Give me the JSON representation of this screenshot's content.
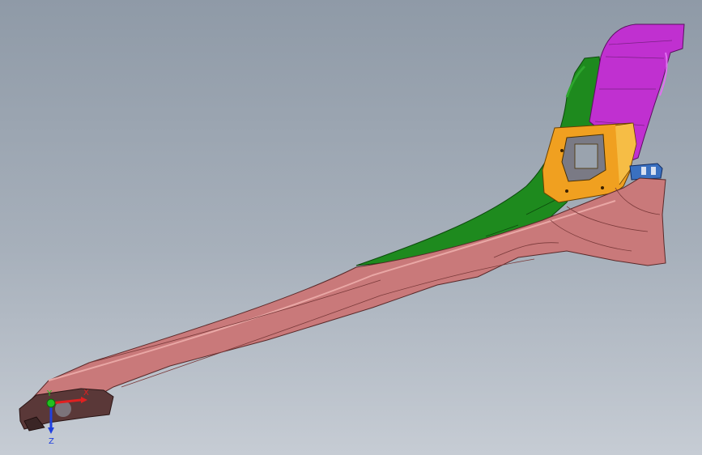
{
  "viewport": {
    "background_top": "#8f9aa7",
    "background_bottom": "#c6ccd4"
  },
  "model": {
    "parts": [
      {
        "name": "main-beam",
        "color": "#c9797a"
      },
      {
        "name": "green-panel",
        "color": "#1e8a1e"
      },
      {
        "name": "orange-bracket",
        "color": "#f0a020"
      },
      {
        "name": "magenta-panel",
        "color": "#c030d0"
      },
      {
        "name": "blue-clip",
        "color": "#3a70c0"
      }
    ]
  },
  "triad": {
    "x_label": "X",
    "y_label": "Y",
    "z_label": "Z",
    "x_color": "#e02020",
    "y_color": "#20c020",
    "z_color": "#2040e0"
  }
}
